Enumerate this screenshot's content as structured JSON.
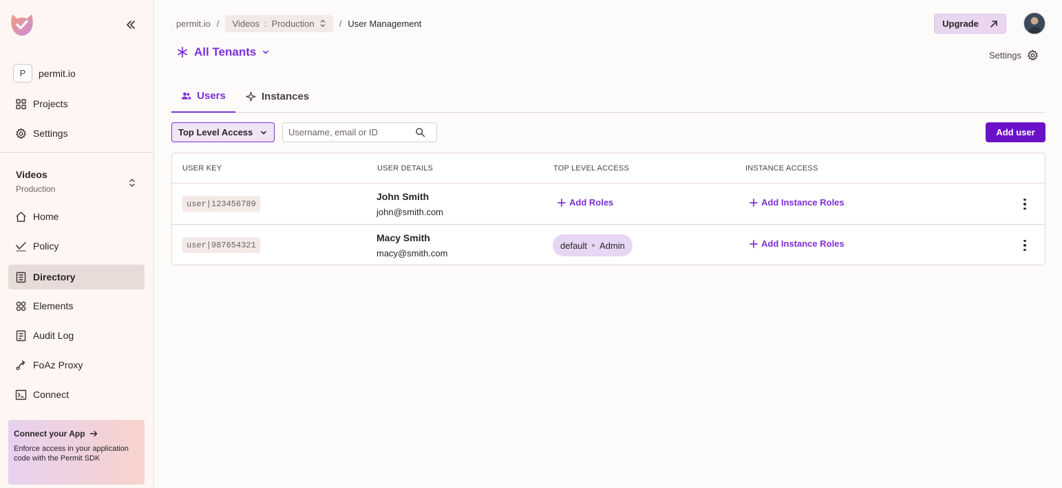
{
  "sidebar": {
    "org": {
      "initial": "P",
      "name": "permit.io"
    },
    "top_items": [
      {
        "label": "Projects",
        "icon": "grid-icon"
      },
      {
        "label": "Settings",
        "icon": "gear-icon"
      }
    ],
    "project": {
      "name": "Videos",
      "env": "Production"
    },
    "items": [
      {
        "label": "Home",
        "icon": "home-icon"
      },
      {
        "label": "Policy",
        "icon": "policy-icon"
      },
      {
        "label": "Directory",
        "icon": "directory-icon",
        "active": true
      },
      {
        "label": "Elements",
        "icon": "elements-icon"
      },
      {
        "label": "Audit Log",
        "icon": "audit-log-icon"
      },
      {
        "label": "FoAz Proxy",
        "icon": "proxy-icon"
      },
      {
        "label": "Connect",
        "icon": "terminal-icon"
      }
    ],
    "promo": {
      "title": "Connect your App",
      "text": "Enforce access in your application code with the Permit SDK"
    }
  },
  "header": {
    "breadcrumb": {
      "root": "permit.io",
      "project": "Videos",
      "env_sep": ":",
      "env": "Production",
      "current": "User Management",
      "separator": "/"
    },
    "upgrade_label": "Upgrade",
    "tenant_selector": "All Tenants",
    "settings_label": "Settings"
  },
  "tabs": [
    {
      "label": "Users",
      "active": true
    },
    {
      "label": "Instances",
      "active": false
    }
  ],
  "toolbar": {
    "filter_label": "Top Level Access",
    "search_placeholder": "Username, email or ID",
    "add_user_label": "Add user"
  },
  "table": {
    "columns": [
      "USER KEY",
      "USER DETAILS",
      "TOP LEVEL ACCESS",
      "INSTANCE ACCESS"
    ],
    "rows": [
      {
        "key": "user|123456789",
        "name": "John Smith",
        "email": "john@smith.com",
        "top_level_action": "Add Roles",
        "instance_action": "Add Instance Roles"
      },
      {
        "key": "user|987654321",
        "name": "Macy Smith",
        "email": "macy@smith.com",
        "role": {
          "tenant": "default",
          "role": "Admin"
        },
        "instance_action": "Add Instance Roles"
      }
    ]
  },
  "colors": {
    "accent": "#7d2fd6",
    "primary_button": "#6b12c9",
    "sidebar_bg": "#fdf6f3",
    "active_nav_bg": "#e8dcd8"
  }
}
